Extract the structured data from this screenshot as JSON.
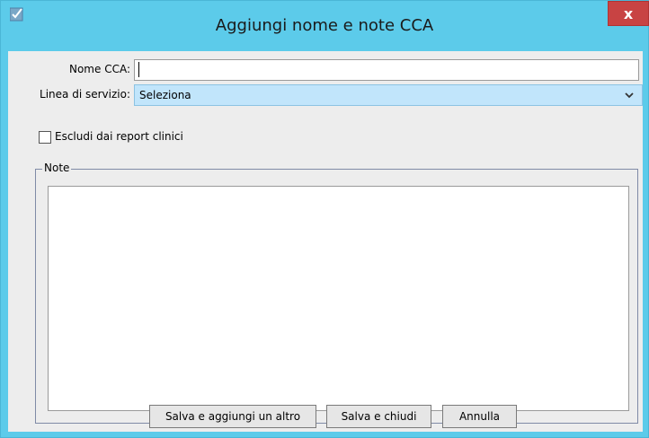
{
  "window": {
    "title": "Aggiungi nome e note CCA",
    "close_glyph": "x",
    "app_icon": "app-icon"
  },
  "form": {
    "name_label": "Nome CCA:",
    "name_value": "",
    "service_line_label": "Linea di servizio:",
    "service_line_selected": "Seleziona",
    "exclude_label": "Escludi dai report clinici",
    "exclude_checked": false,
    "notes_legend": "Note",
    "notes_value": ""
  },
  "buttons": {
    "save_add": "Salva e aggiungi un altro",
    "save_close": "Salva e chiudi",
    "cancel": "Annulla"
  },
  "colors": {
    "titlebar": "#5ccbea",
    "close_button": "#c84343",
    "select_background": "#c1e5fb",
    "client_background": "#ededed"
  }
}
